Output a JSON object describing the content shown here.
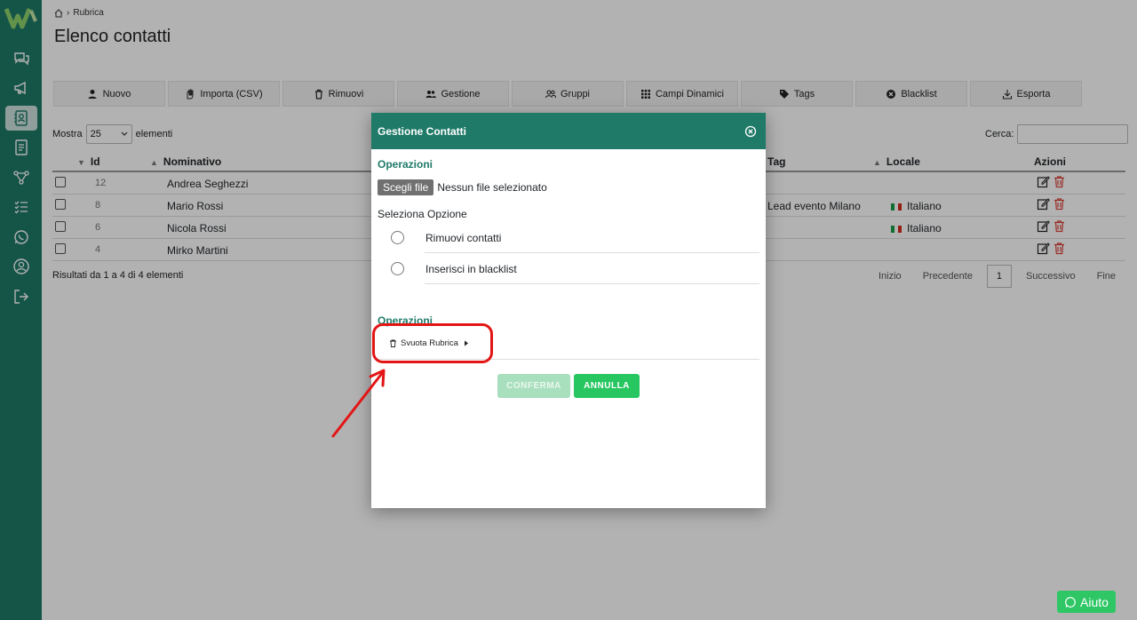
{
  "sidebar": {
    "logo_text": "W",
    "items": [
      "chat-icon",
      "megaphone-icon",
      "contacts-icon",
      "document-icon",
      "flow-icon",
      "checklist-icon",
      "whatsapp-icon",
      "user-icon",
      "logout-icon"
    ],
    "active_index": 2
  },
  "breadcrumb": {
    "current": "Rubrica"
  },
  "page": {
    "title": "Elenco contatti"
  },
  "toolbar": {
    "buttons": [
      {
        "label": "Nuovo",
        "icon": "user-plus-icon"
      },
      {
        "label": "Importa (CSV)",
        "icon": "hand-icon"
      },
      {
        "label": "Rimuovi",
        "icon": "trash-icon"
      },
      {
        "label": "Gestione",
        "icon": "users-icon"
      },
      {
        "label": "Gruppi",
        "icon": "group-icon"
      },
      {
        "label": "Campi Dinamici",
        "icon": "grid-icon"
      },
      {
        "label": "Tags",
        "icon": "tag-icon"
      },
      {
        "label": "Blacklist",
        "icon": "ban-icon"
      },
      {
        "label": "Esporta",
        "icon": "export-icon"
      }
    ]
  },
  "table_controls": {
    "show_prefix": "Mostra",
    "show_value": "25",
    "show_suffix": "elementi",
    "search_label": "Cerca:"
  },
  "table": {
    "headers": {
      "id": "Id",
      "name": "Nominativo",
      "tag": "Tag",
      "locale": "Locale",
      "actions": "Azioni"
    },
    "rows": [
      {
        "id": "12",
        "name": "Andrea Seghezzi",
        "tag": "",
        "locale": ""
      },
      {
        "id": "8",
        "name": "Mario Rossi",
        "tag": "Lead evento Milano",
        "locale": "Italiano"
      },
      {
        "id": "6",
        "name": "Nicola Rossi",
        "tag": "",
        "locale": "Italiano"
      },
      {
        "id": "4",
        "name": "Mirko Martini",
        "tag": "",
        "locale": ""
      }
    ]
  },
  "results_text": "Risultati da 1 a 4 di 4 elementi",
  "pagination": {
    "first": "Inizio",
    "prev": "Precedente",
    "current": "1",
    "next": "Successivo",
    "last": "Fine"
  },
  "modal": {
    "title": "Gestione Contatti",
    "section1_title": "Operazioni",
    "file_button": "Scegli file",
    "file_status": "Nessun file selezionato",
    "select_label": "Seleziona Opzione",
    "options": [
      "Rimuovi contatti",
      "Inserisci in blacklist"
    ],
    "section2_title": "Operazioni",
    "svuota_label": "Svuota Rubrica",
    "confirm_label": "CONFERMA",
    "cancel_label": "ANNULLA"
  },
  "help": {
    "label": "Aiuto"
  },
  "colors": {
    "brand": "#1f7a68",
    "accent_green": "#27c661",
    "highlight": "#e31515"
  }
}
